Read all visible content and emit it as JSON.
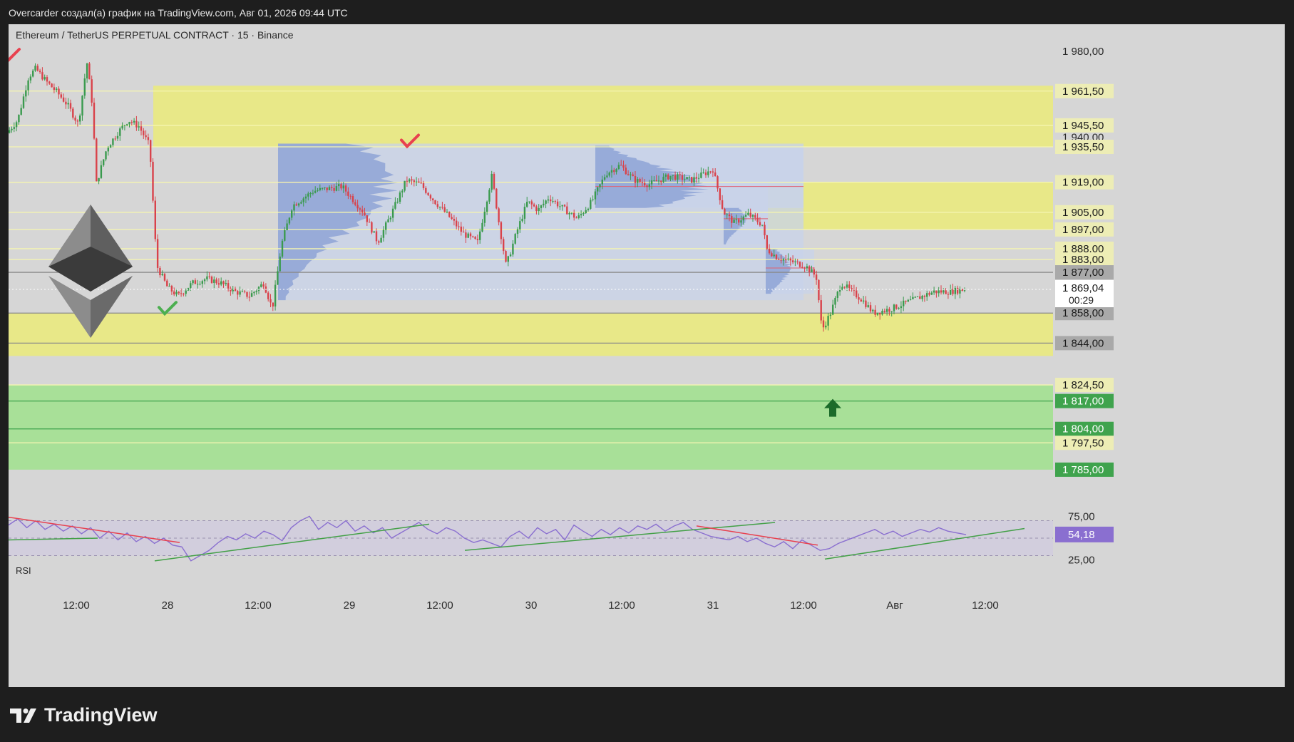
{
  "header": {
    "caption": "Overcarder создал(а) график на TradingView.com, Авг 01, 2026 09:44 UTC",
    "symbol": "Ethereum / TetherUS PERPETUAL CONTRACT · 15 · Binance"
  },
  "brand": {
    "name": "TradingView"
  },
  "colors": {
    "bull": "#3a9a4e",
    "bear": "#d9424a",
    "yellow_zone": "#e8e888",
    "green_zone": "#a8e098",
    "profile": "#c8d3ea",
    "rsi_band": "#d2cedd",
    "rsi_line": "#8a6fd0",
    "trend_green": "#43a047",
    "trend_red": "#e8414f"
  },
  "chart_data": [
    {
      "type": "candlestick",
      "title": "Ethereum / TetherUS PERPETUAL CONTRACT · 15 · Binance",
      "ylim": [
        1776,
        1990
      ],
      "x_ticks": [
        "12:00",
        "28",
        "12:00",
        "29",
        "12:00",
        "30",
        "12:00",
        "31",
        "12:00",
        "Авг",
        "12:00"
      ],
      "x_domain": [
        0,
        1465
      ],
      "x_tick_values": [
        95,
        223,
        350,
        478,
        605,
        733,
        860,
        988,
        1115,
        1243,
        1370
      ],
      "price_path": [
        [
          0,
          1942
        ],
        [
          15,
          1948
        ],
        [
          30,
          1968
        ],
        [
          40,
          1972
        ],
        [
          55,
          1966
        ],
        [
          70,
          1961
        ],
        [
          85,
          1955
        ],
        [
          100,
          1946
        ],
        [
          112,
          1975
        ],
        [
          120,
          1954
        ],
        [
          125,
          1918
        ],
        [
          140,
          1935
        ],
        [
          155,
          1942
        ],
        [
          170,
          1948
        ],
        [
          185,
          1945
        ],
        [
          200,
          1936
        ],
        [
          210,
          1880
        ],
        [
          225,
          1870
        ],
        [
          240,
          1866
        ],
        [
          260,
          1872
        ],
        [
          280,
          1874
        ],
        [
          300,
          1872
        ],
        [
          320,
          1868
        ],
        [
          340,
          1866
        ],
        [
          360,
          1872
        ],
        [
          372,
          1860
        ],
        [
          385,
          1890
        ],
        [
          400,
          1908
        ],
        [
          430,
          1915
        ],
        [
          470,
          1917
        ],
        [
          500,
          1905
        ],
        [
          520,
          1891
        ],
        [
          540,
          1905
        ],
        [
          560,
          1920
        ],
        [
          580,
          1918
        ],
        [
          600,
          1910
        ],
        [
          620,
          1903
        ],
        [
          640,
          1895
        ],
        [
          660,
          1891
        ],
        [
          680,
          1922
        ],
        [
          690,
          1900
        ],
        [
          700,
          1880
        ],
        [
          715,
          1896
        ],
        [
          730,
          1910
        ],
        [
          745,
          1906
        ],
        [
          760,
          1912
        ],
        [
          775,
          1908
        ],
        [
          800,
          1902
        ],
        [
          820,
          1910
        ],
        [
          840,
          1923
        ],
        [
          860,
          1927
        ],
        [
          880,
          1920
        ],
        [
          900,
          1918
        ],
        [
          930,
          1922
        ],
        [
          960,
          1920
        ],
        [
          990,
          1925
        ],
        [
          1005,
          1905
        ],
        [
          1020,
          1900
        ],
        [
          1040,
          1904
        ],
        [
          1060,
          1899
        ],
        [
          1065,
          1888
        ],
        [
          1080,
          1884
        ],
        [
          1100,
          1882
        ],
        [
          1120,
          1880
        ],
        [
          1135,
          1875
        ],
        [
          1143,
          1850
        ],
        [
          1155,
          1858
        ],
        [
          1170,
          1872
        ],
        [
          1185,
          1868
        ],
        [
          1200,
          1864
        ],
        [
          1215,
          1858
        ],
        [
          1240,
          1860
        ],
        [
          1270,
          1864
        ],
        [
          1300,
          1868
        ],
        [
          1320,
          1868
        ],
        [
          1343,
          1869.04
        ]
      ],
      "current_price": "1 869,04",
      "countdown": "00:29",
      "zones": [
        {
          "kind": "yellow",
          "from": 1935.5,
          "to": 1964,
          "x0": 203,
          "x1": 1465
        },
        {
          "kind": "yellow",
          "from": 1897,
          "to": 1919,
          "x0": 1065,
          "x1": 1465
        },
        {
          "kind": "yellow",
          "from": 1838,
          "to": 1858,
          "x0": 0,
          "x1": 1465
        },
        {
          "kind": "green",
          "from": 1785,
          "to": 1824.5,
          "x0": 0,
          "x1": 1465
        }
      ],
      "profiles": [
        {
          "x0": 378,
          "x1": 1115,
          "low": 1864,
          "high": 1937,
          "poc": 1919
        },
        {
          "x0": 823,
          "x1": 1115,
          "low": 1907,
          "high": 1936,
          "poc": 1917
        },
        {
          "x0": 1003,
          "x1": 1065,
          "low": 1890,
          "high": 1907,
          "poc": 1902
        },
        {
          "x0": 1062,
          "x1": 1130,
          "low": 1867,
          "high": 1888,
          "poc": 1879
        }
      ],
      "levels": [
        {
          "value": 1961.5,
          "label": "1 961,50",
          "style": "yellow",
          "line": true
        },
        {
          "value": 1945.5,
          "label": "1 945,50",
          "style": "yellow",
          "line": true
        },
        {
          "value": 1935.5,
          "label": "1 935,50",
          "style": "yellow",
          "line": true
        },
        {
          "value": 1919,
          "label": "1 919,00",
          "style": "yellow",
          "line": true
        },
        {
          "value": 1905,
          "label": "1 905,00",
          "style": "yellow",
          "line": true
        },
        {
          "value": 1897,
          "label": "1 897,00",
          "style": "yellow",
          "line": true
        },
        {
          "value": 1888,
          "label": "1 888,00",
          "style": "yellow",
          "line": true
        },
        {
          "value": 1883,
          "label": "1 883,00",
          "style": "yellow",
          "line": true
        },
        {
          "value": 1877,
          "label": "1 877,00",
          "style": "gray",
          "line": true
        },
        {
          "value": 1858,
          "label": "1 858,00",
          "style": "gray",
          "line": true
        },
        {
          "value": 1844,
          "label": "1 844,00",
          "style": "gray",
          "line": true
        },
        {
          "value": 1824.5,
          "label": "1 824,50",
          "style": "yellow",
          "line": true
        },
        {
          "value": 1817,
          "label": "1 817,00",
          "style": "green",
          "line": true
        },
        {
          "value": 1804,
          "label": "1 804,00",
          "style": "green",
          "line": true
        },
        {
          "value": 1797.5,
          "label": "1 797,50",
          "style": "yellow",
          "line": true
        },
        {
          "value": 1785,
          "label": "1 785,00",
          "style": "green",
          "line": false
        }
      ],
      "axis_plain_labels": [
        {
          "value": 1980,
          "label": "1 980,00"
        },
        {
          "value": 1940,
          "label": "1 940,00"
        }
      ],
      "markers": [
        {
          "kind": "check",
          "color": "red",
          "x": 2,
          "price": 1978
        },
        {
          "kind": "check",
          "color": "red",
          "x": 562,
          "price": 1938
        },
        {
          "kind": "check",
          "color": "green",
          "x": 222,
          "price": 1860
        },
        {
          "kind": "arrow-up",
          "color": "darkgreen",
          "x": 1156,
          "price": 1814
        }
      ]
    },
    {
      "type": "line",
      "title": "RSI",
      "ylim": [
        10,
        90
      ],
      "band": [
        30,
        70
      ],
      "y_ticks": [
        {
          "value": 75,
          "label": "75,00"
        },
        {
          "value": 25,
          "label": "25,00"
        }
      ],
      "current": {
        "value": 54.18,
        "label": "54,18"
      },
      "values": [
        65,
        72,
        62,
        70,
        60,
        66,
        58,
        64,
        55,
        62,
        50,
        58,
        48,
        56,
        46,
        52,
        44,
        50,
        42,
        40,
        24,
        30,
        36,
        45,
        52,
        48,
        55,
        50,
        58,
        54,
        47,
        62,
        70,
        75,
        60,
        68,
        62,
        70,
        58,
        64,
        56,
        62,
        50,
        56,
        62,
        68,
        60,
        55,
        62,
        58,
        50,
        45,
        48,
        44,
        40,
        52,
        58,
        50,
        62,
        55,
        60,
        48,
        65,
        58,
        52,
        60,
        54,
        62,
        56,
        64,
        60,
        66,
        58,
        64,
        68,
        60,
        56,
        52,
        50,
        48,
        52,
        46,
        50,
        44,
        40,
        46,
        38,
        48,
        42,
        36,
        38,
        44,
        48,
        52,
        56,
        60,
        54,
        58,
        52,
        56,
        60,
        57,
        62,
        58,
        56,
        54
      ],
      "values_x_end": 1343,
      "trendlines": [
        {
          "color": "red",
          "x0": 0,
          "v0": 74,
          "x1": 240,
          "v1": 45
        },
        {
          "color": "green",
          "x0": 0,
          "v0": 48,
          "x1": 125,
          "v1": 50
        },
        {
          "color": "green",
          "x0": 205,
          "v0": 24,
          "x1": 590,
          "v1": 66
        },
        {
          "color": "green",
          "x0": 640,
          "v0": 36,
          "x1": 1075,
          "v1": 68
        },
        {
          "color": "red",
          "x0": 965,
          "v0": 64,
          "x1": 1135,
          "v1": 42
        },
        {
          "color": "green",
          "x0": 1145,
          "v0": 26,
          "x1": 1425,
          "v1": 61
        }
      ]
    }
  ]
}
